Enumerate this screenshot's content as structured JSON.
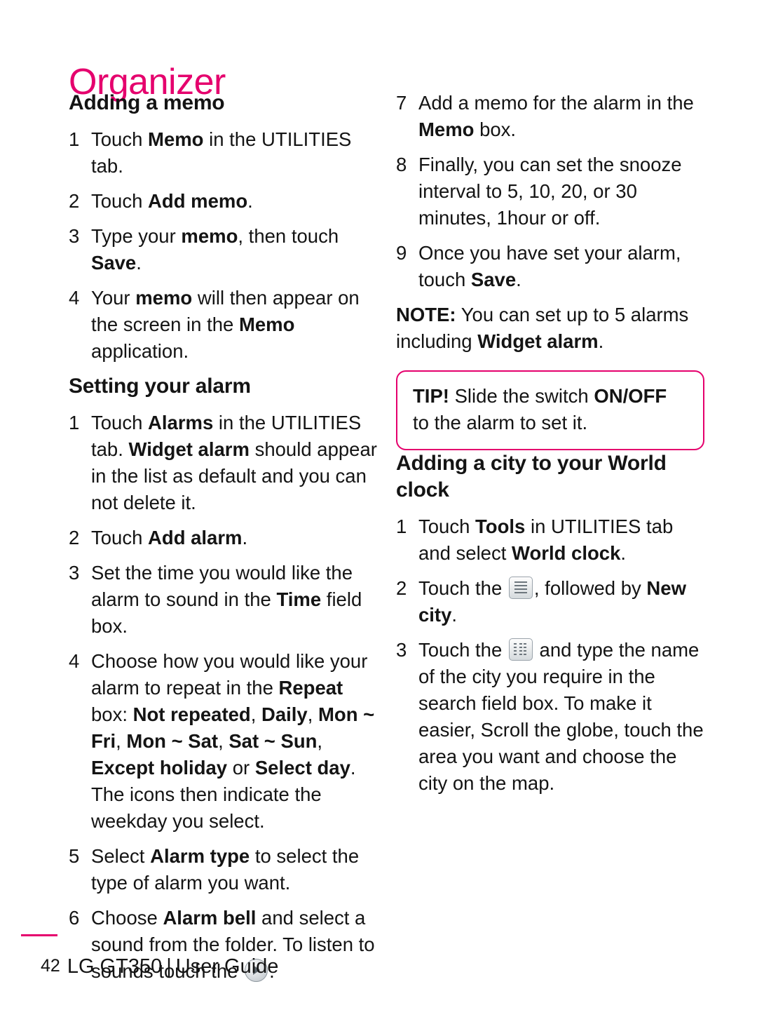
{
  "page": {
    "title": "Organizer",
    "footer": {
      "page_number": "42",
      "device": "LG GT350",
      "separator": "|",
      "guide": "User Guide"
    }
  },
  "left_column": {
    "section1": {
      "heading": "Adding a memo",
      "steps": [
        {
          "num": "1",
          "parts": [
            {
              "t": "Touch ",
              "b": false
            },
            {
              "t": "Memo",
              "b": true
            },
            {
              "t": " in the UTILITIES tab.",
              "b": false
            }
          ]
        },
        {
          "num": "2",
          "parts": [
            {
              "t": "Touch ",
              "b": false
            },
            {
              "t": "Add memo",
              "b": true
            },
            {
              "t": ".",
              "b": false
            }
          ]
        },
        {
          "num": "3",
          "parts": [
            {
              "t": "Type your ",
              "b": false
            },
            {
              "t": "memo",
              "b": true
            },
            {
              "t": ", then touch ",
              "b": false
            },
            {
              "t": "Save",
              "b": true
            },
            {
              "t": ".",
              "b": false
            }
          ]
        },
        {
          "num": "4",
          "parts": [
            {
              "t": "Your ",
              "b": false
            },
            {
              "t": "memo",
              "b": true
            },
            {
              "t": " will then appear on the screen in the ",
              "b": false
            },
            {
              "t": "Memo",
              "b": true
            },
            {
              "t": " application.",
              "b": false
            }
          ]
        }
      ]
    },
    "section2": {
      "heading": "Setting your alarm",
      "steps": [
        {
          "num": "1",
          "parts": [
            {
              "t": "Touch ",
              "b": false
            },
            {
              "t": "Alarms",
              "b": true
            },
            {
              "t": " in the UTILITIES tab. ",
              "b": false
            },
            {
              "t": "Widget alarm",
              "b": true
            },
            {
              "t": " should appear in the list as default and you can not delete it.",
              "b": false
            }
          ]
        },
        {
          "num": "2",
          "parts": [
            {
              "t": "Touch ",
              "b": false
            },
            {
              "t": "Add alarm",
              "b": true
            },
            {
              "t": ".",
              "b": false
            }
          ]
        },
        {
          "num": "3",
          "parts": [
            {
              "t": "Set the time you would like the alarm to sound in the ",
              "b": false
            },
            {
              "t": "Time",
              "b": true
            },
            {
              "t": " field box.",
              "b": false
            }
          ]
        },
        {
          "num": "4",
          "parts": [
            {
              "t": "Choose how you would like your alarm to repeat in the ",
              "b": false
            },
            {
              "t": "Repeat",
              "b": true
            },
            {
              "t": " box: ",
              "b": false
            },
            {
              "t": "Not repeated",
              "b": true
            },
            {
              "t": ", ",
              "b": false
            },
            {
              "t": "Daily",
              "b": true
            },
            {
              "t": ", ",
              "b": false
            },
            {
              "t": "Mon ~ Fri",
              "b": true
            },
            {
              "t": ", ",
              "b": false
            },
            {
              "t": "Mon ~ Sat",
              "b": true
            },
            {
              "t": ", ",
              "b": false
            },
            {
              "t": "Sat ~ Sun",
              "b": true
            },
            {
              "t": ", ",
              "b": false
            },
            {
              "t": "Except holiday",
              "b": true
            },
            {
              "t": " or ",
              "b": false
            },
            {
              "t": "Select day",
              "b": true
            },
            {
              "t": ". The icons then indicate the weekday you select.",
              "b": false
            }
          ]
        },
        {
          "num": "5",
          "parts": [
            {
              "t": "Select ",
              "b": false
            },
            {
              "t": "Alarm type",
              "b": true
            },
            {
              "t": " to select the type of alarm you want.",
              "b": false
            }
          ]
        },
        {
          "num": "6",
          "parts": [
            {
              "t": "Choose ",
              "b": false
            },
            {
              "t": "Alarm bell",
              "b": true
            },
            {
              "t": " and select a sound from the folder. To listen to sounds touch the ",
              "b": false
            },
            {
              "t": "__ICON_PLAY__",
              "b": false
            },
            {
              "t": ".",
              "b": false
            }
          ]
        }
      ]
    }
  },
  "right_column": {
    "steps_continued": [
      {
        "num": "7",
        "parts": [
          {
            "t": "Add a memo for the alarm in the ",
            "b": false
          },
          {
            "t": "Memo",
            "b": true
          },
          {
            "t": " box.",
            "b": false
          }
        ]
      },
      {
        "num": "8",
        "parts": [
          {
            "t": "Finally, you can set the snooze interval to 5, 10, 20, or 30 minutes, 1hour or off.",
            "b": false
          }
        ]
      },
      {
        "num": "9",
        "parts": [
          {
            "t": "Once you have set your alarm, touch ",
            "b": false
          },
          {
            "t": "Save",
            "b": true
          },
          {
            "t": ".",
            "b": false
          }
        ]
      }
    ],
    "note": [
      {
        "t": "NOTE:",
        "b": true
      },
      {
        "t": " You can set up to 5 alarms including ",
        "b": false
      },
      {
        "t": "Widget alarm",
        "b": true
      },
      {
        "t": ".",
        "b": false
      }
    ],
    "tip": [
      {
        "t": "TIP!",
        "b": true
      },
      {
        "t": " Slide the switch ",
        "b": false
      },
      {
        "t": "ON/OFF",
        "b": true
      },
      {
        "t": " to the alarm to set it.",
        "b": false
      }
    ],
    "section": {
      "heading": "Adding a city to your World clock",
      "steps": [
        {
          "num": "1",
          "parts": [
            {
              "t": "Touch ",
              "b": false
            },
            {
              "t": "Tools",
              "b": true
            },
            {
              "t": " in UTILITIES tab and select ",
              "b": false
            },
            {
              "t": "World clock",
              "b": true
            },
            {
              "t": ".",
              "b": false
            }
          ]
        },
        {
          "num": "2",
          "parts": [
            {
              "t": "Touch the ",
              "b": false
            },
            {
              "t": "__ICON_LIST__",
              "b": false
            },
            {
              "t": ", followed by ",
              "b": false
            },
            {
              "t": "New city",
              "b": true
            },
            {
              "t": ".",
              "b": false
            }
          ]
        },
        {
          "num": "3",
          "parts": [
            {
              "t": "Touch the ",
              "b": false
            },
            {
              "t": "__ICON_LINES__",
              "b": false
            },
            {
              "t": " and type the name of the city you require in the search field box. To make it easier, Scroll the globe, touch the area you want and choose the city on the map.",
              "b": false
            }
          ]
        }
      ]
    }
  }
}
